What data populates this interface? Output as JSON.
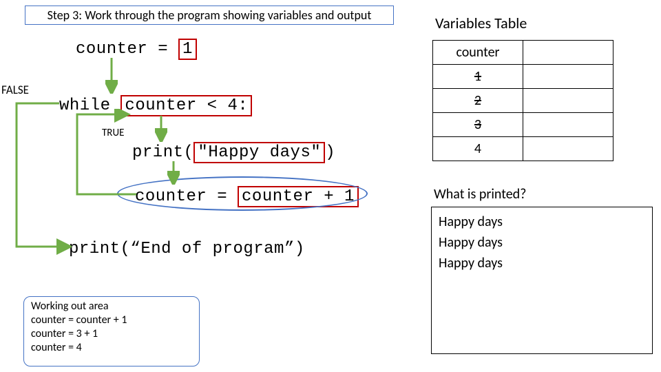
{
  "banner": "Step 3: Work through the program showing variables and output",
  "code": {
    "line1_a": "counter =",
    "line1_b": "1",
    "line2_a": "while",
    "line2_b": "counter < 4:",
    "line3_a": "print(",
    "line3_b": "\"Happy days\"",
    "line3_c": ")",
    "line4_a": "counter =",
    "line4_b": "counter + 1",
    "line5": "print(“End of program”)"
  },
  "labels": {
    "false": "FALSE",
    "true": "TRUE"
  },
  "vars": {
    "title": "Variables Table",
    "header": "counter",
    "rows": [
      "1",
      "2",
      "3",
      "4"
    ],
    "struck": [
      true,
      true,
      true,
      false
    ]
  },
  "printed": {
    "question": "What is printed?",
    "lines": [
      "Happy days",
      "Happy days",
      "Happy days"
    ]
  },
  "workout": {
    "title": "Working out area",
    "l1": "counter = counter + 1",
    "l2": "counter = 3 + 1",
    "l3": "counter = 4"
  }
}
